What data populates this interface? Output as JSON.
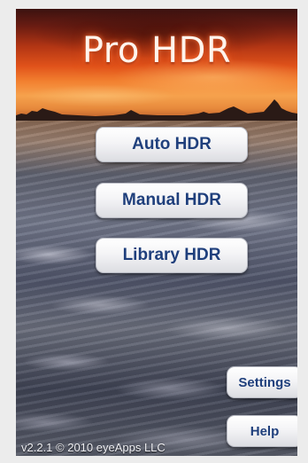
{
  "app": {
    "title": "Pro HDR"
  },
  "menu": {
    "auto_label": "Auto HDR",
    "manual_label": "Manual HDR",
    "library_label": "Library HDR"
  },
  "footer": {
    "settings_label": "Settings",
    "help_label": "Help",
    "version_text": "v2.2.1 © 2010 eyeApps LLC"
  },
  "colors": {
    "button_text": "#1f3f7c",
    "button_face": "#f4f4f6",
    "title_glow": "#ff6a2a"
  }
}
